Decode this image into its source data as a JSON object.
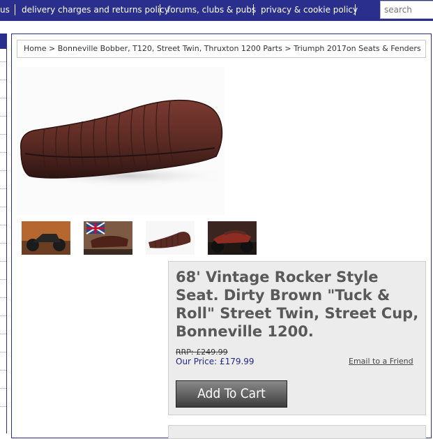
{
  "nav": {
    "items": [
      "us",
      "delivery charges and returns policy",
      "forums, clubs & pubs",
      "privacy & cookie policy"
    ],
    "search_placeholder": "search"
  },
  "breadcrumb": {
    "home": "Home",
    "sep": ">",
    "level1": "Bonneville Bobber, T120, Street Twin, Thruxton 1200 Parts",
    "level2": "Triumph 2017on Seats & Fenders"
  },
  "product": {
    "title": "68' Vintage Rocker Style Seat. Dirty Brown \"Tuck & Roll\" Street Twin, Street Cup, Bonneville 1200.",
    "rrp": "RRP: £249.99",
    "price": "Our Price: £179.99",
    "email_link": "Email to a Friend",
    "add_to_cart": "Add To Cart"
  },
  "colors": {
    "brand": "#2a2f8e",
    "seat": "#5a2a23",
    "price": "#22278a"
  }
}
